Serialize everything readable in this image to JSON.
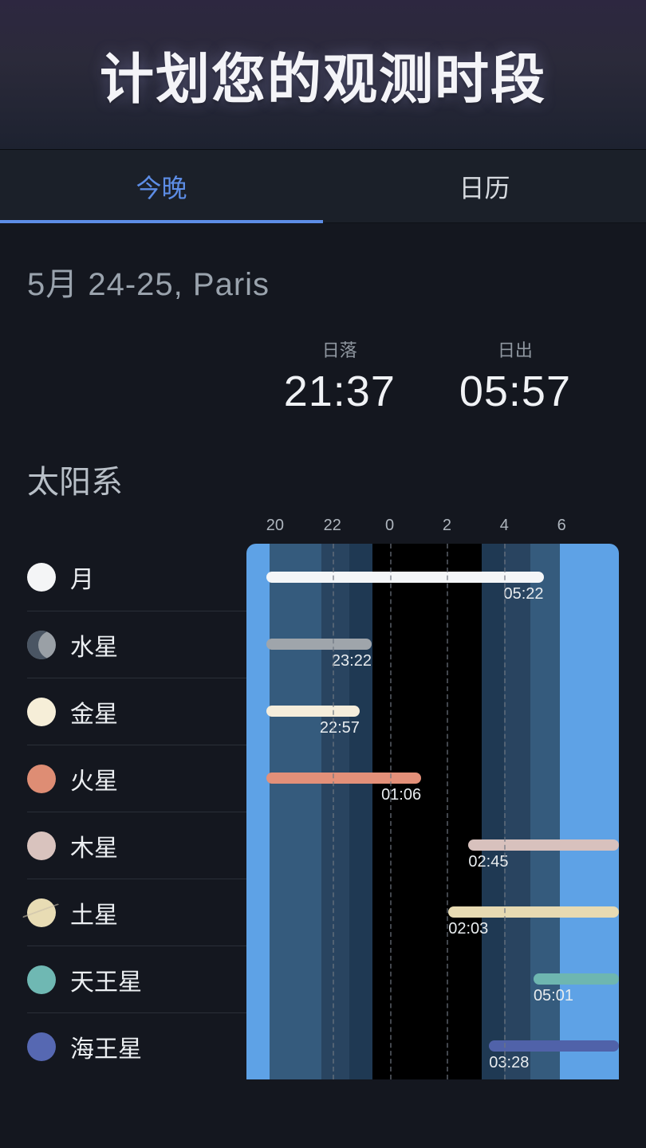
{
  "header": {
    "title": "计划您的观测时段"
  },
  "tabs": {
    "tonight": "今晚",
    "calendar": "日历",
    "active": "tonight"
  },
  "date_location": "5月 24-25, Paris",
  "sun": {
    "sunset_label": "日落",
    "sunset_time": "21:37",
    "sunrise_label": "日出",
    "sunrise_time": "05:57"
  },
  "section": "太阳系",
  "axis": {
    "ticks": [
      "20",
      "22",
      "0",
      "2",
      "4",
      "6"
    ],
    "start": 19,
    "end": 8
  },
  "bands": [
    {
      "type": "light",
      "from": 19.0,
      "to": 19.8
    },
    {
      "type": "sky",
      "from": 19.8,
      "to": 21.62
    },
    {
      "type": "twilight",
      "from": 21.62,
      "to": 22.6
    },
    {
      "type": "night",
      "from": 22.6,
      "to": 23.4
    },
    {
      "type": "dark",
      "from": 23.4,
      "to": 27.2
    },
    {
      "type": "night",
      "from": 27.2,
      "to": 28.0
    },
    {
      "type": "twilight",
      "from": 28.0,
      "to": 28.9
    },
    {
      "type": "sky",
      "from": 28.9,
      "to": 29.95
    },
    {
      "type": "light",
      "from": 29.95,
      "to": 32.0
    }
  ],
  "gridlines": [
    22,
    24,
    26,
    28
  ],
  "bodies": [
    {
      "name": "月",
      "icon_color": "#f4f5f6",
      "icon_class": "",
      "bar": {
        "from": 19.7,
        "to": 29.37,
        "color": "#f4f6f8",
        "label": "05:22",
        "label_align": "end"
      }
    },
    {
      "name": "水星",
      "icon_color": "#9aa0a6",
      "icon_class": "moon-phase",
      "bar": {
        "from": 19.7,
        "to": 23.37,
        "color": "#9fa5ab",
        "label": "23:22",
        "label_align": "end"
      }
    },
    {
      "name": "金星",
      "icon_color": "#f6eed8",
      "icon_class": "",
      "bar": {
        "from": 19.7,
        "to": 22.95,
        "color": "#f5eddb",
        "label": "22:57",
        "label_align": "end"
      }
    },
    {
      "name": "火星",
      "icon_color": "#de8d74",
      "icon_class": "",
      "bar": {
        "from": 19.7,
        "to": 25.1,
        "color": "#e39079",
        "label": "01:06",
        "label_align": "end"
      }
    },
    {
      "name": "木星",
      "icon_color": "#d9c3be",
      "icon_class": "",
      "bar": {
        "from": 26.75,
        "to": 32.0,
        "color": "#d8c1bd",
        "label": "02:45",
        "label_align": "start"
      }
    },
    {
      "name": "土星",
      "icon_color": "#e8dcb4",
      "icon_class": "saturn-ring",
      "bar": {
        "from": 26.05,
        "to": 32.0,
        "color": "#e7dab2",
        "label": "02:03",
        "label_align": "start"
      }
    },
    {
      "name": "天王星",
      "icon_color": "#6fb8b3",
      "icon_class": "",
      "bar": {
        "from": 29.02,
        "to": 32.0,
        "color": "#6eb6b0",
        "label": "05:01",
        "label_align": "start"
      }
    },
    {
      "name": "海王星",
      "icon_color": "#5668b2",
      "icon_class": "",
      "bar": {
        "from": 27.47,
        "to": 32.0,
        "color": "#5062a9",
        "label": "03:28",
        "label_align": "start"
      }
    }
  ],
  "chart_data": {
    "type": "bar",
    "title": "Visibility timeline (hours from 19:00 → next-day 08:00)",
    "x_range_hours": [
      19,
      32
    ],
    "sunset": "21:37",
    "sunrise": "05:57",
    "series": [
      {
        "name": "月",
        "visible_from": "19:42",
        "visible_to": "05:22"
      },
      {
        "name": "水星",
        "visible_from": "19:42",
        "visible_to": "23:22"
      },
      {
        "name": "金星",
        "visible_from": "19:42",
        "visible_to": "22:57"
      },
      {
        "name": "火星",
        "visible_from": "19:42",
        "visible_to": "01:06"
      },
      {
        "name": "木星",
        "visible_from": "02:45",
        "visible_to": "08:00"
      },
      {
        "name": "土星",
        "visible_from": "02:03",
        "visible_to": "08:00"
      },
      {
        "name": "天王星",
        "visible_from": "05:01",
        "visible_to": "08:00"
      },
      {
        "name": "海王星",
        "visible_from": "03:28",
        "visible_to": "08:00"
      }
    ]
  }
}
